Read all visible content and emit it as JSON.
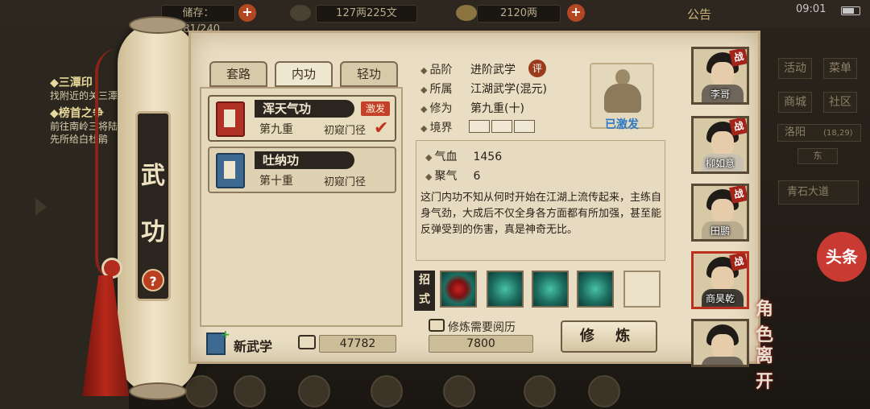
{
  "topbar": {
    "res1": "储存：181/240",
    "res2": "127两225文",
    "res3": "2120两",
    "announce": "公告",
    "time": "09:01"
  },
  "background": {
    "quest1_title": "◆三潭印",
    "quest1_text": "找附近的关三潭印",
    "quest2_title": "◆榜首之争",
    "quest2_text": "前往南岭三将陆凤先所给白杜鹃",
    "menu": [
      "活动",
      "菜单",
      "商城",
      "社区"
    ],
    "location": "洛阳",
    "coords": "(18,29)",
    "compass": "东",
    "road": "青石大道",
    "toutiao": "头条"
  },
  "scroll": {
    "title_top": "武",
    "title_bottom": "功",
    "help": "?"
  },
  "tabs": [
    {
      "label": "套路",
      "active": false
    },
    {
      "label": "内功",
      "active": true
    },
    {
      "label": "轻功",
      "active": false
    }
  ],
  "skills": [
    {
      "name": "浑天气功",
      "level": "第九重",
      "rank": "初窥门径",
      "badge": "激发",
      "book_color": "red",
      "selected": true
    },
    {
      "name": "吐纳功",
      "level": "第十重",
      "rank": "初窥门径",
      "badge": "",
      "book_color": "blue",
      "selected": false
    }
  ],
  "details": {
    "grade_label": "品阶",
    "grade_value": "进阶武学",
    "grade_badge": "评",
    "belong_label": "所属",
    "belong_value": "江湖武学(混元)",
    "cultivation_label": "修为",
    "cultivation_value": "第九重(十)",
    "realm_label": "境界",
    "portrait_status": "已激发",
    "hp_label": "气血",
    "hp_value": "1456",
    "qi_label": "聚气",
    "qi_value": "6",
    "description": "这门内功不知从何时开始在江湖上流传起来，主练自身气劲，大成后不仅全身各方面都有所加强，甚至能反弹受到的伤害，真是神奇无比。"
  },
  "moves": {
    "label": "招式",
    "icons": [
      "blood-move-icon",
      "meditate-move-icon",
      "aura-move-icon",
      "palm-move-icon",
      "empty-slot"
    ]
  },
  "footer": {
    "new_skill_label": "新武学",
    "experience_value": "47782",
    "train_requirement_label": "修炼需要阅历",
    "train_requirement_value": "7800",
    "train_button": "修 炼"
  },
  "roster": [
    {
      "name": "李哥",
      "badge": "战",
      "selected": false
    },
    {
      "name": "柳如意",
      "badge": "战",
      "selected": false
    },
    {
      "name": "田鹏",
      "badge": "战",
      "selected": false
    },
    {
      "name": "商昊乾",
      "badge": "战",
      "selected": true
    },
    {
      "name": "",
      "badge": "",
      "selected": false
    }
  ],
  "side_actions": {
    "role_label": "角色",
    "leave_label": "离开"
  },
  "colors": {
    "parchment": "#e9dec3",
    "accent_red": "#c5402a",
    "status_blue": "#2a79c7",
    "ink_dark": "#2b2520"
  }
}
